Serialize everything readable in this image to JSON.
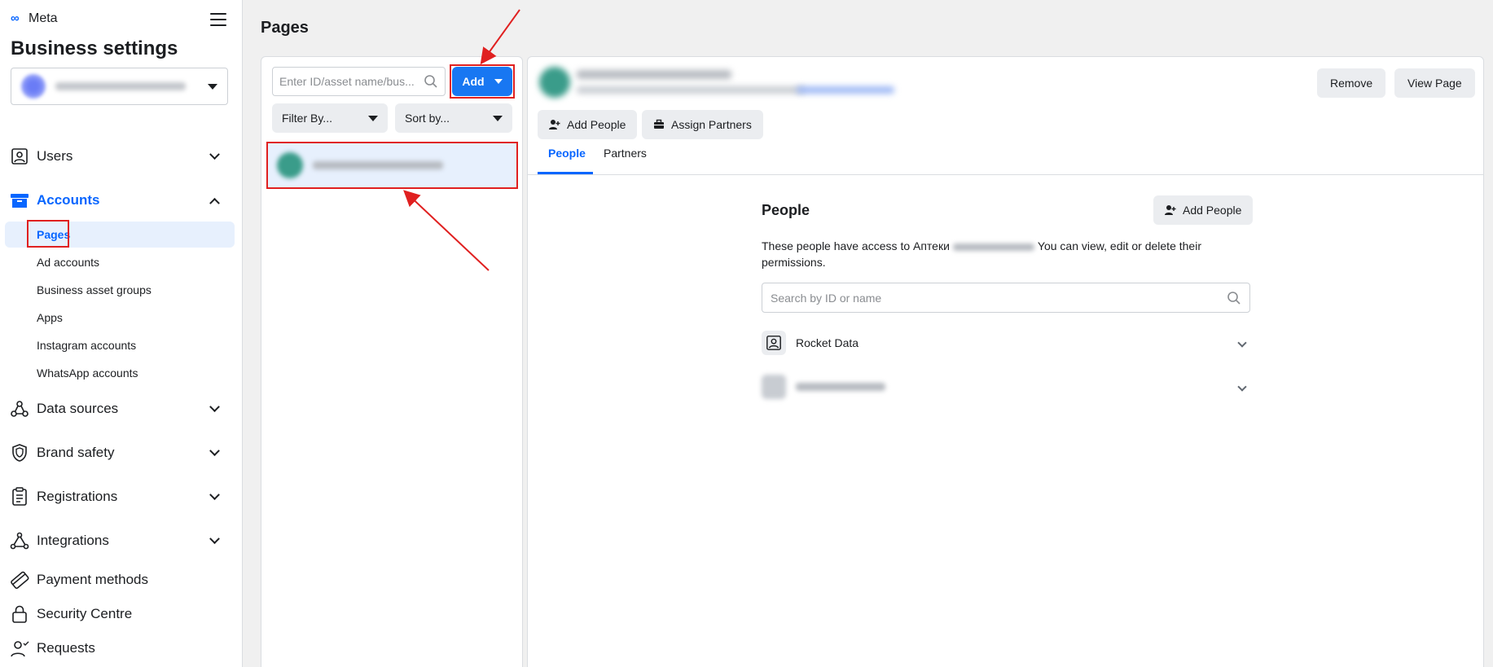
{
  "sidebar": {
    "brand": "Meta",
    "title": "Business settings",
    "nav": [
      {
        "label": "Users"
      },
      {
        "label": "Accounts"
      },
      {
        "label": "Data sources"
      },
      {
        "label": "Brand safety"
      },
      {
        "label": "Registrations"
      },
      {
        "label": "Integrations"
      },
      {
        "label": "Payment methods"
      },
      {
        "label": "Security Centre"
      },
      {
        "label": "Requests"
      }
    ],
    "accounts_sub": [
      {
        "label": "Pages"
      },
      {
        "label": "Ad accounts"
      },
      {
        "label": "Business asset groups"
      },
      {
        "label": "Apps"
      },
      {
        "label": "Instagram accounts"
      },
      {
        "label": "WhatsApp accounts"
      }
    ]
  },
  "main": {
    "title": "Pages",
    "search_placeholder": "Enter ID/asset name/bus...",
    "add_label": "Add",
    "filter_label": "Filter By...",
    "sort_label": "Sort by..."
  },
  "detail": {
    "remove_label": "Remove",
    "view_page_label": "View Page",
    "add_people_label": "Add People",
    "assign_partners_label": "Assign Partners",
    "tabs": [
      {
        "label": "People"
      },
      {
        "label": "Partners"
      }
    ],
    "people_title": "People",
    "people_add_label": "Add People",
    "desc_prefix": "These people have access to Аптеки",
    "desc_suffix": "You can view, edit or delete their permissions.",
    "people_search_placeholder": "Search by ID or name",
    "people": [
      {
        "name": "Rocket Data"
      }
    ]
  },
  "colors": {
    "accent": "#0866ff",
    "button_blue": "#1877f2",
    "annotation_red": "#e02020"
  }
}
